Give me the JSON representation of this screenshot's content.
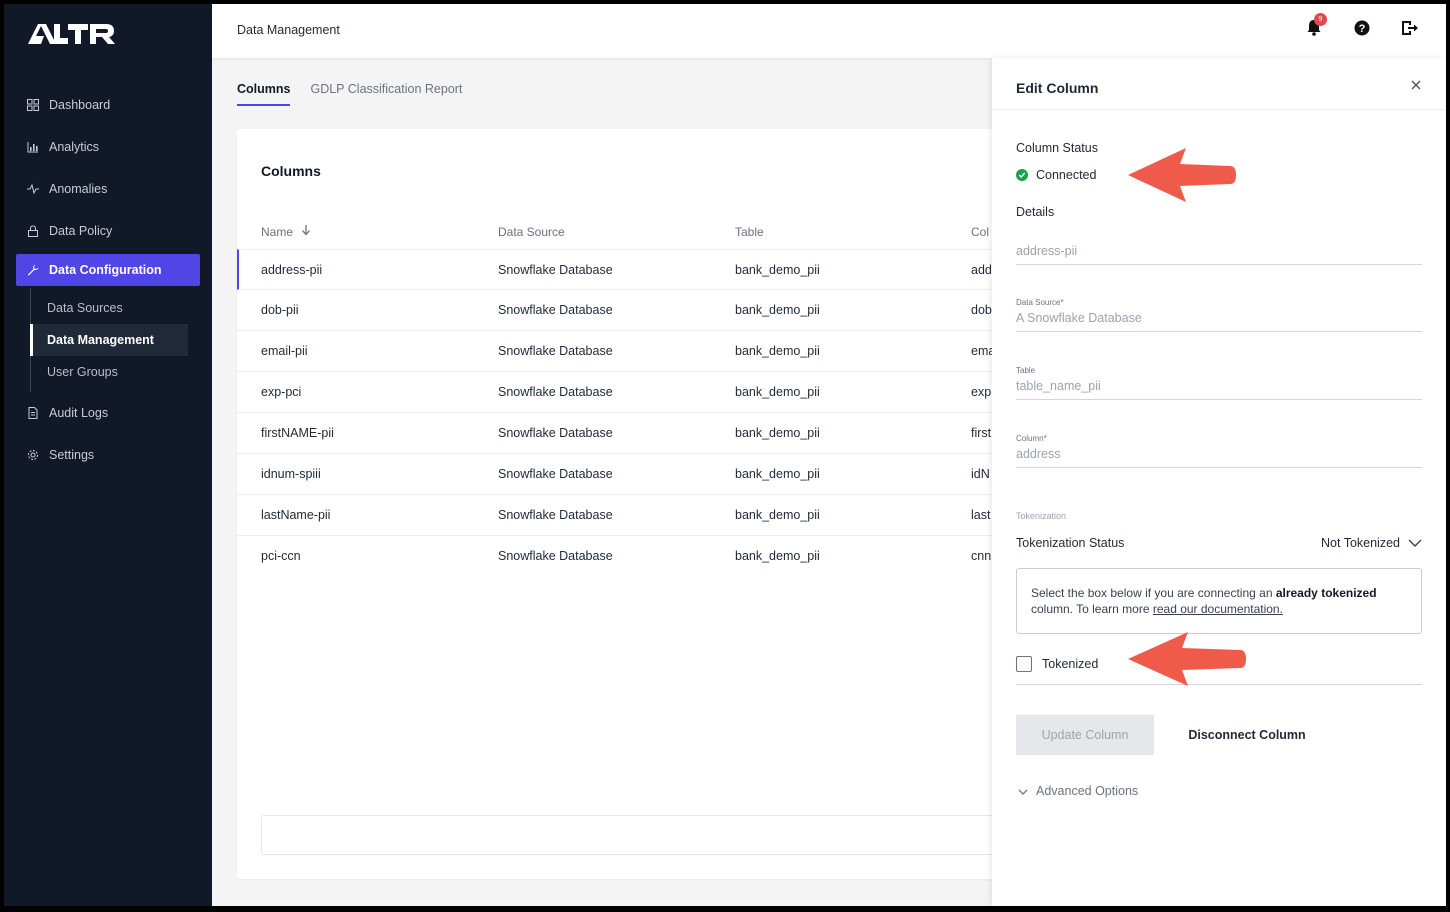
{
  "app": {
    "logo_text": "ALTR"
  },
  "topbar": {
    "title": "Data Management",
    "notification_count": "9"
  },
  "sidebar": {
    "items": [
      {
        "label": "Dashboard",
        "icon": "grid-icon"
      },
      {
        "label": "Analytics",
        "icon": "bar-chart-icon"
      },
      {
        "label": "Anomalies",
        "icon": "pulse-icon"
      },
      {
        "label": "Data Policy",
        "icon": "lock-icon"
      },
      {
        "label": "Data Configuration",
        "icon": "wrench-icon"
      },
      {
        "label": "Audit Logs",
        "icon": "document-icon"
      },
      {
        "label": "Settings",
        "icon": "gear-icon"
      }
    ],
    "subitems": [
      {
        "label": "Data Sources"
      },
      {
        "label": "Data Management"
      },
      {
        "label": "User Groups"
      }
    ]
  },
  "tabs": [
    {
      "label": "Columns"
    },
    {
      "label": "GDLP Classification Report"
    }
  ],
  "table": {
    "title": "Columns",
    "headers": [
      "Name",
      "Data Source",
      "Table",
      "Col"
    ],
    "rows": [
      {
        "name": "address-pii",
        "source": "Snowflake Database",
        "table": "bank_demo_pii",
        "col": "add"
      },
      {
        "name": "dob-pii",
        "source": "Snowflake Database",
        "table": "bank_demo_pii",
        "col": "dob"
      },
      {
        "name": "email-pii",
        "source": "Snowflake Database",
        "table": "bank_demo_pii",
        "col": "ema"
      },
      {
        "name": "exp-pci",
        "source": "Snowflake Database",
        "table": "bank_demo_pii",
        "col": "exp"
      },
      {
        "name": "firstNAME-pii",
        "source": "Snowflake Database",
        "table": "bank_demo_pii",
        "col": "first"
      },
      {
        "name": "idnum-spiii",
        "source": "Snowflake Database",
        "table": "bank_demo_pii",
        "col": "idN"
      },
      {
        "name": "lastName-pii",
        "source": "Snowflake Database",
        "table": "bank_demo_pii",
        "col": "last"
      },
      {
        "name": "pci-ccn",
        "source": "Snowflake Database",
        "table": "bank_demo_pii",
        "col": "cnn"
      }
    ]
  },
  "panel": {
    "title": "Edit Column",
    "status_label": "Column Status",
    "status_value": "Connected",
    "details_label": "Details",
    "name_value": "address-pii",
    "data_source_label": "Data Source*",
    "data_source_value": "A Snowflake Database",
    "table_label": "Table",
    "table_value": "table_name_pii",
    "column_label": "Column*",
    "column_value": "address",
    "tokenization_section": "Tokenization",
    "tokenization_status_label": "Tokenization Status",
    "tokenization_status_value": "Not Tokenized",
    "info_pre": "Select the box below if you are connecting an ",
    "info_bold": "already tokenized",
    "info_mid": " column. To learn more ",
    "info_link": "read our documentation.",
    "tokenized_label": "Tokenized",
    "update_button": "Update Column",
    "disconnect_button": "Disconnect Column",
    "advanced_label": "Advanced Options"
  },
  "colors": {
    "accent": "#4f46e5",
    "sidebar_bg": "#111827",
    "success": "#16a34a",
    "annotation_arrow": "#f05a4a",
    "badge": "#e5484d"
  }
}
